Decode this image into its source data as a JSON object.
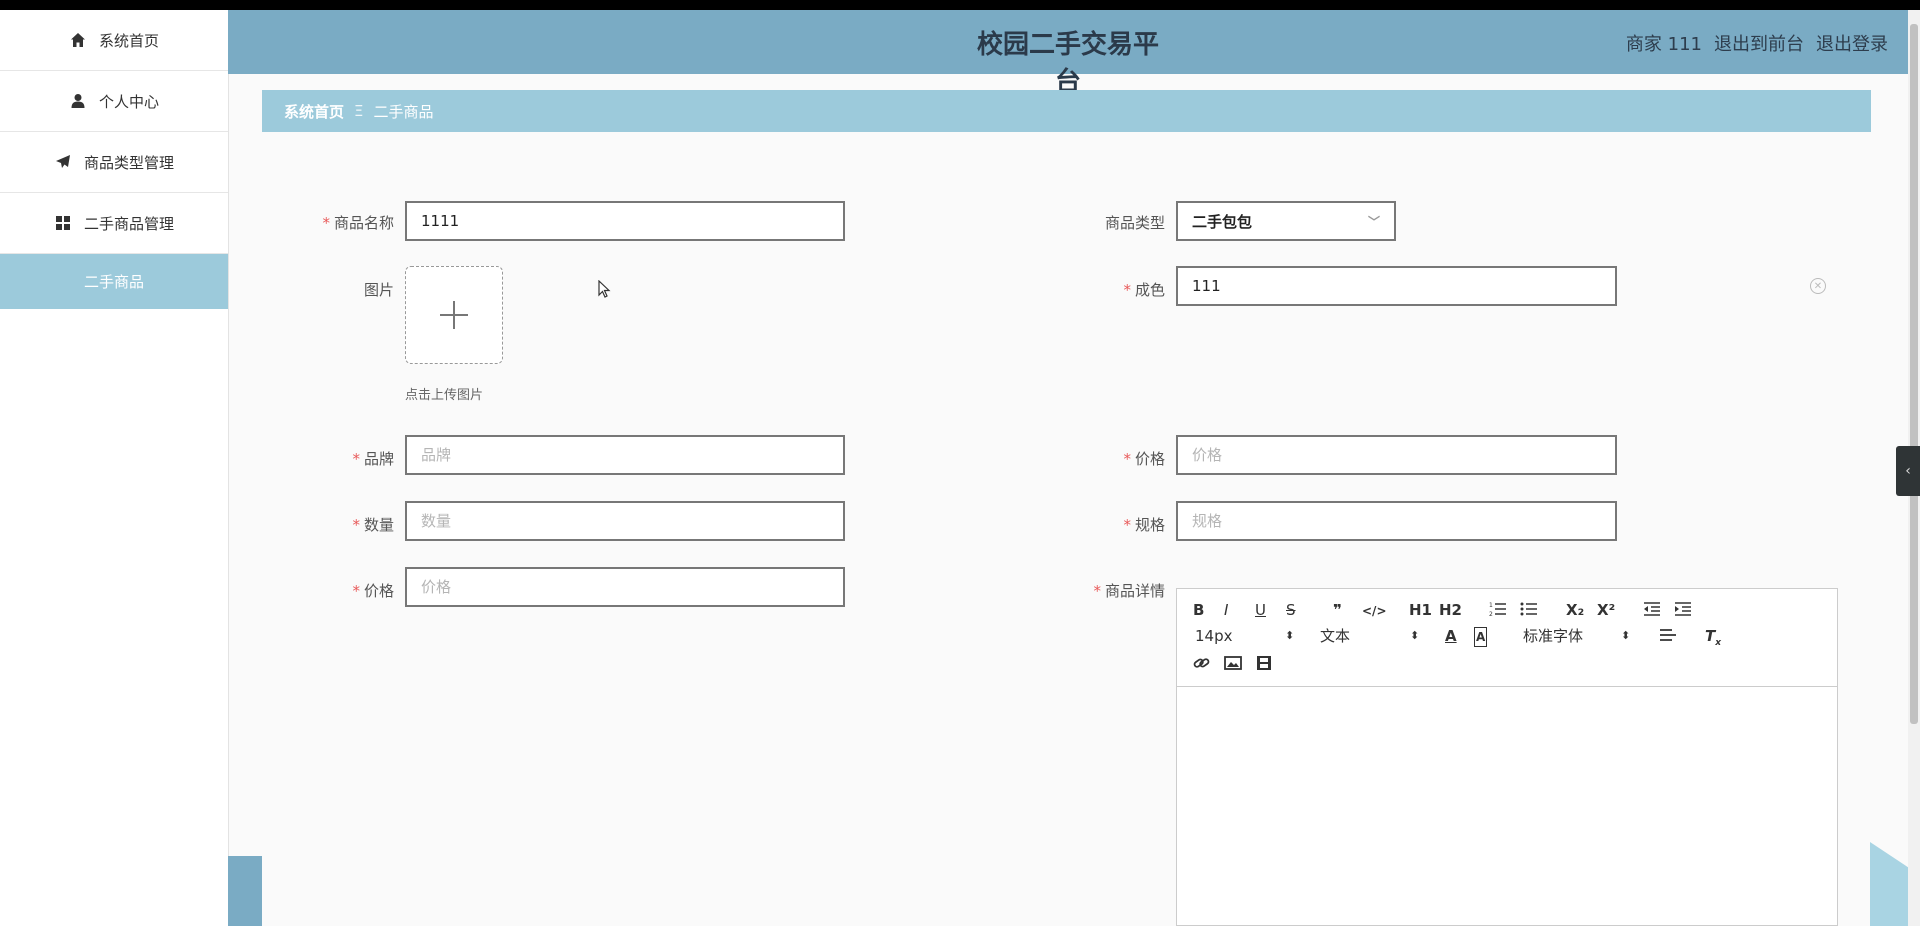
{
  "sidebar": {
    "items": [
      {
        "label": "系统首页",
        "icon": "home-icon"
      },
      {
        "label": "个人中心",
        "icon": "user-icon"
      },
      {
        "label": "商品类型管理",
        "icon": "paper-plane-icon"
      },
      {
        "label": "二手商品管理",
        "icon": "grid-icon"
      }
    ],
    "sub_active": "二手商品"
  },
  "header": {
    "title": "校园二手交易平台",
    "user": "商家 111",
    "front_link": "退出到前台",
    "logout_link": "退出登录"
  },
  "breadcrumb": {
    "home": "系统首页",
    "separator": "Ξ",
    "current": "二手商品"
  },
  "form": {
    "name": {
      "label": "商品名称",
      "value": "1111"
    },
    "type": {
      "label": "商品类型",
      "value": "二手包包"
    },
    "image": {
      "label": "图片",
      "hint": "点击上传图片"
    },
    "condition": {
      "label": "成色",
      "value": "111"
    },
    "brand": {
      "label": "品牌",
      "placeholder": "品牌"
    },
    "price_right": {
      "label": "价格",
      "placeholder": "价格"
    },
    "quantity": {
      "label": "数量",
      "placeholder": "数量"
    },
    "spec": {
      "label": "规格",
      "placeholder": "规格"
    },
    "price_left": {
      "label": "价格",
      "placeholder": "价格"
    },
    "details": {
      "label": "商品详情"
    },
    "required_mark": "*"
  },
  "editor": {
    "font_size": "14px",
    "text_style": "文本",
    "font_family": "标准字体",
    "buttons_row1": [
      "B",
      "I",
      "U",
      "S",
      "❞",
      "</>",
      "H1",
      "H2",
      "ordered-list",
      "bullet-list",
      "X₂",
      "X²",
      "outdent",
      "indent"
    ]
  },
  "colors": {
    "header": "#7aabc4",
    "accent": "#9ccadb",
    "required": "#e85a5a"
  }
}
